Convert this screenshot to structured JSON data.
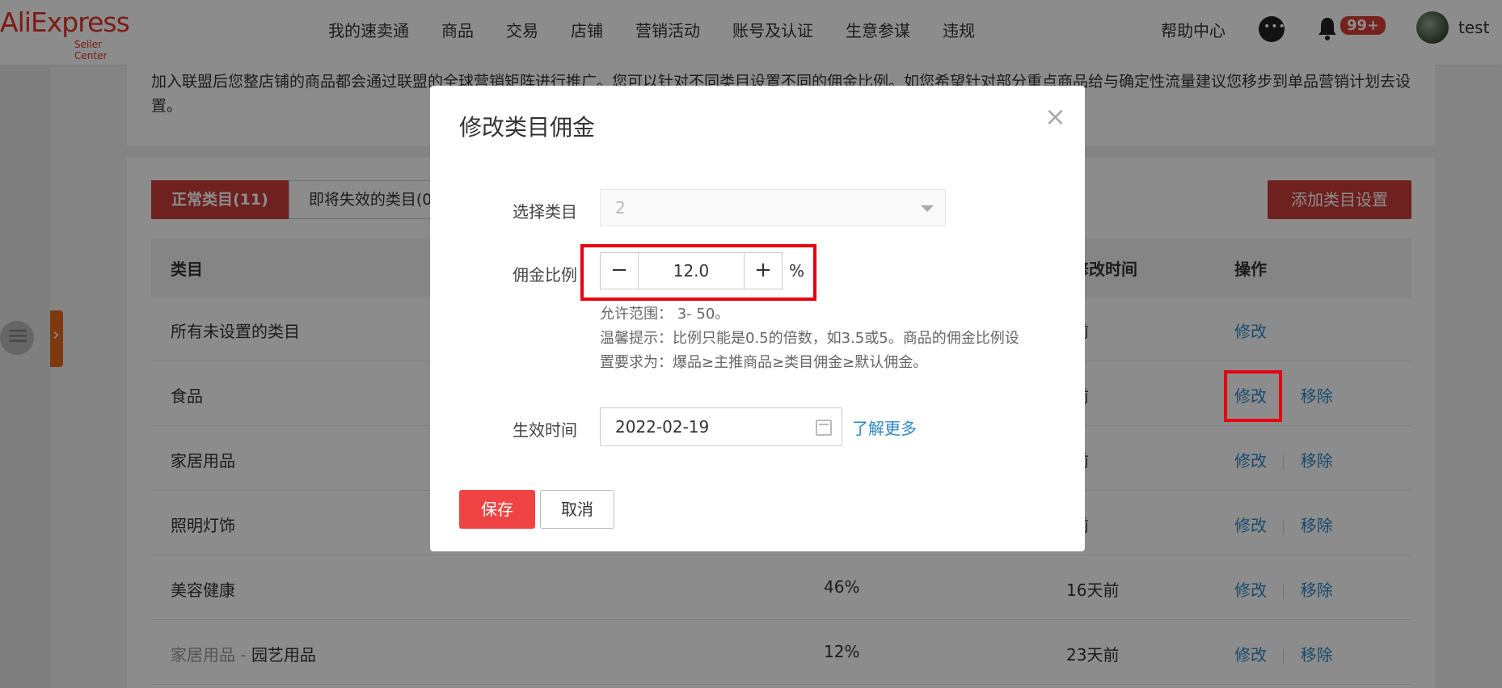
{
  "header": {
    "logo_text": "AliExpress",
    "logo_sub": "Seller Center",
    "nav": [
      "我的速卖通",
      "商品",
      "交易",
      "店铺",
      "营销活动",
      "账号及认证",
      "生意参谋",
      "违规"
    ],
    "help": "帮助中心",
    "notif_badge": "99+",
    "username": "test"
  },
  "info_text": "加入联盟后您整店铺的商品都会通过联盟的全球营销矩阵进行推广。您可以针对不同类目设置不同的佣金比例。如您希望针对部分重点商品给与确定性流量建议您移步到单品营销计划去设置。",
  "tabs": [
    {
      "label": "正常类目(11)"
    },
    {
      "label": "即将失效的类目(0"
    }
  ],
  "add_button": "添加类目设置",
  "table": {
    "headers": {
      "category": "类目",
      "modified": "修改时间",
      "action": "操作"
    },
    "rows": [
      {
        "category": "所有未设置的类目",
        "parent": "",
        "rate": "",
        "time": "前",
        "actions": [
          "修改"
        ]
      },
      {
        "category": "食品",
        "parent": "",
        "rate": "",
        "time": "前",
        "actions": [
          "修改",
          "移除"
        ]
      },
      {
        "category": "家居用品",
        "parent": "",
        "rate": "",
        "time": "前",
        "actions": [
          "修改",
          "移除"
        ]
      },
      {
        "category": "照明灯饰",
        "parent": "",
        "rate": "",
        "time": "前",
        "actions": [
          "修改",
          "移除"
        ]
      },
      {
        "category": "美容健康",
        "parent": "",
        "rate": "46%",
        "time": "16天前",
        "actions": [
          "修改",
          "移除"
        ]
      },
      {
        "category": "园艺用品",
        "parent": "家居用品",
        "sep": "-",
        "rate": "12%",
        "time": "23天前",
        "actions": [
          "修改",
          "移除"
        ]
      }
    ]
  },
  "modal": {
    "title": "修改类目佣金",
    "close": "×",
    "select_label": "选择类目",
    "select_value": "2",
    "rate_label": "佣金比例",
    "minus": "−",
    "rate_value": "12.0",
    "plus": "+",
    "percent": "%",
    "hint_range": "允许范围： 3- 50。",
    "hint_tip": "温馨提示：比例只能是0.5的倍数，如3.5或5。商品的佣金比例设置要求为：爆品≥主推商品≥类目佣金≥默认佣金。",
    "date_label": "生效时间",
    "date_value": "2022-02-19",
    "learn_more": "了解更多",
    "save": "保存",
    "cancel": "取消"
  },
  "colors": {
    "brand_red": "#c83c3a",
    "link_blue": "#2e89c7",
    "save_red": "#f04444",
    "highlight_red": "#e60012"
  }
}
